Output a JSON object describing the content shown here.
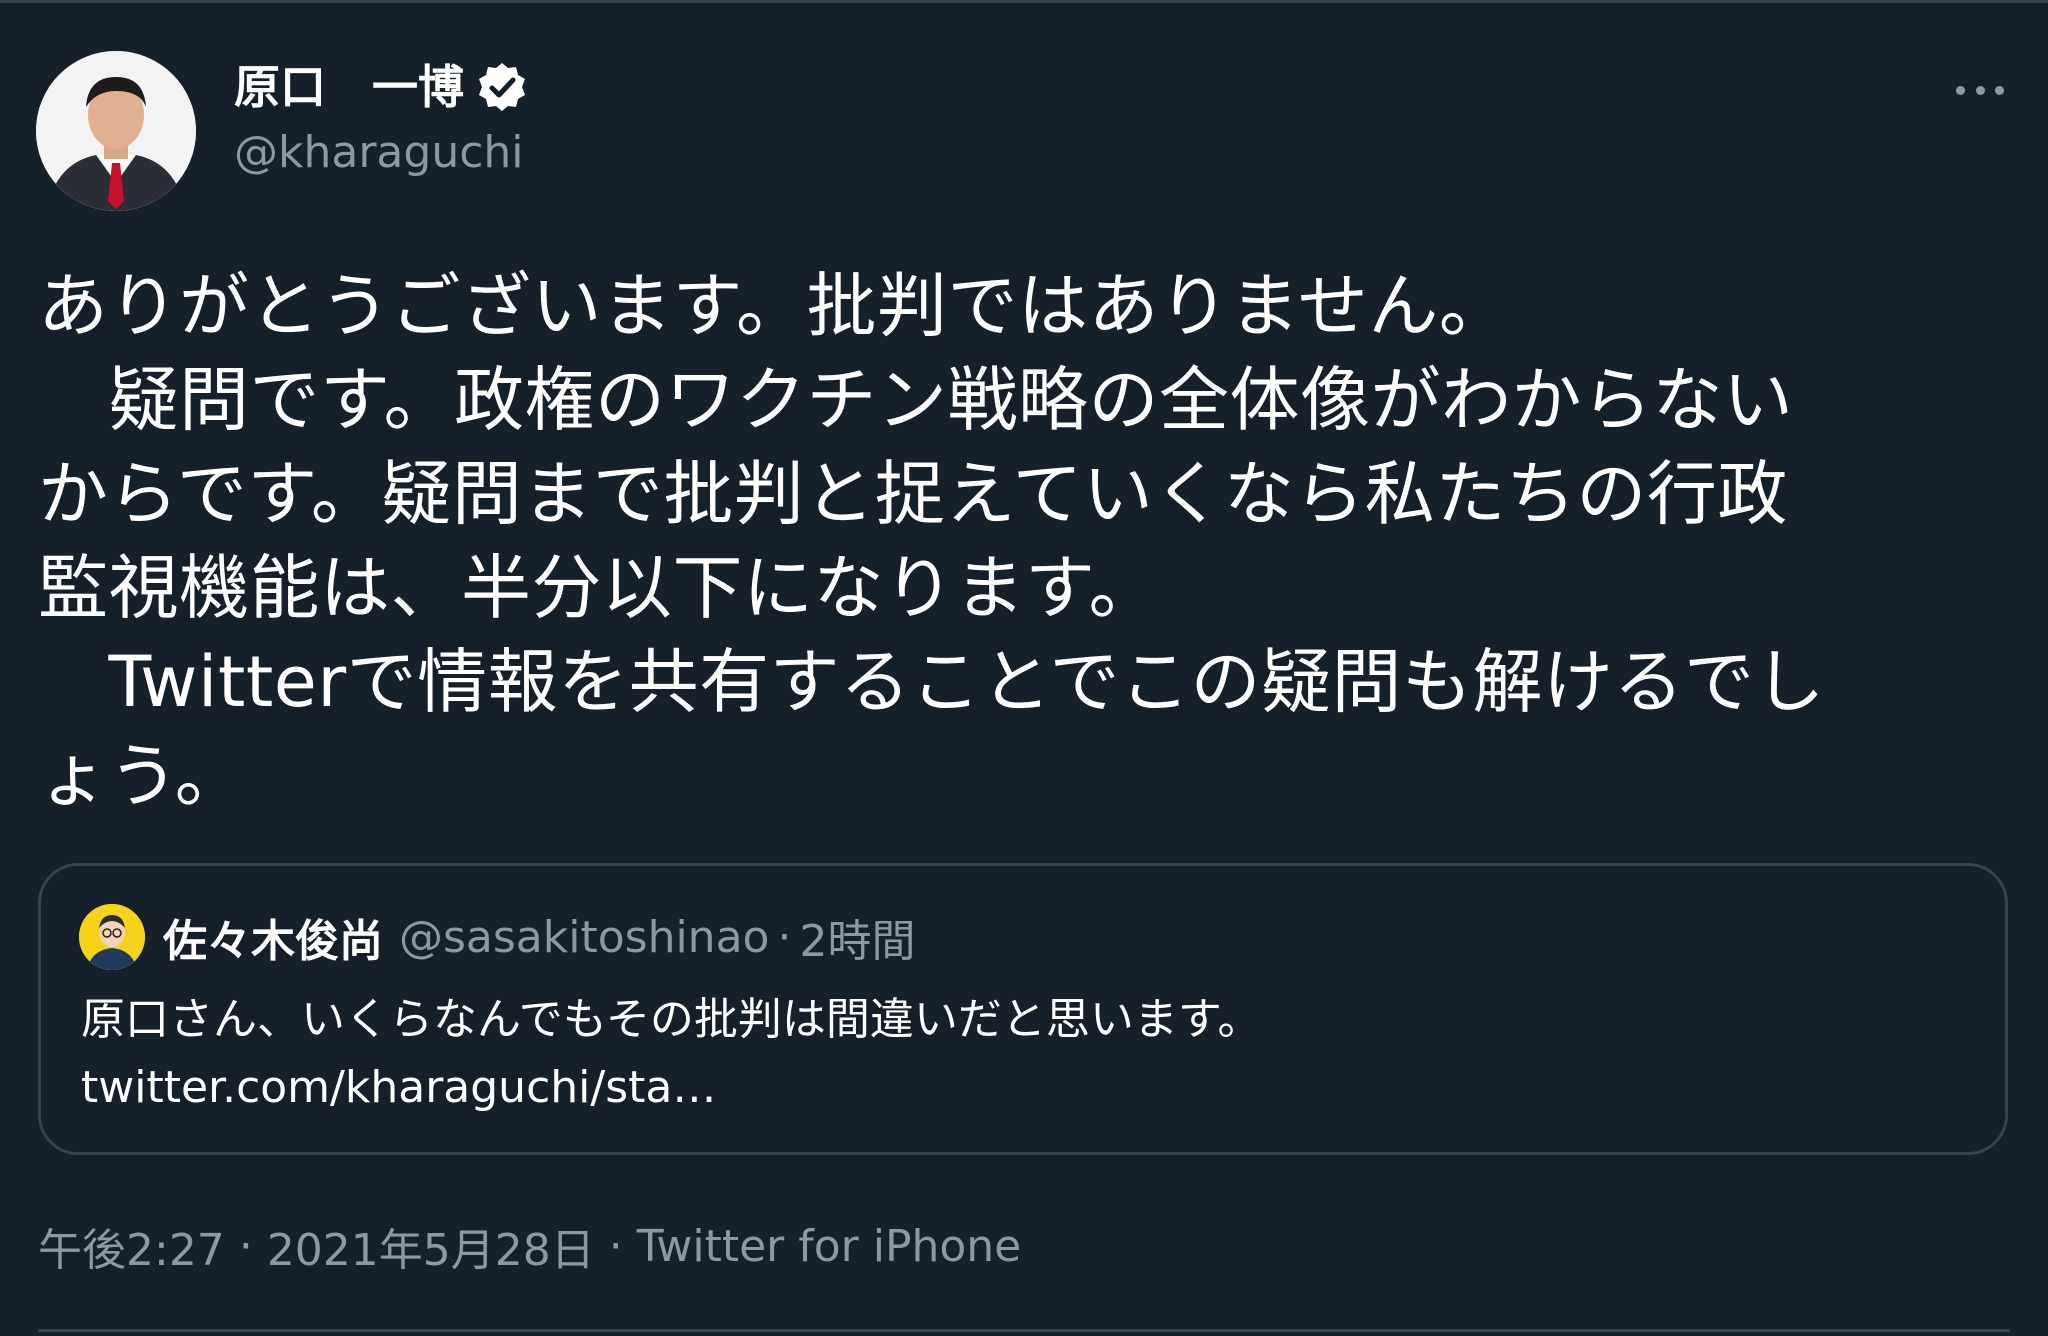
{
  "author": {
    "name": "原口　一博",
    "handle": "@kharaguchi"
  },
  "tweet": {
    "text": "ありがとうございます。批判ではありません。\n　疑問です。政権のワクチン戦略の全体像がわからない\nからです。疑問まで批判と捉えていくなら私たちの行政\n監視機能は、半分以下になります。\n　Twitterで情報を共有することでこの疑問も解けるでし\nょう。"
  },
  "quoted": {
    "name": "佐々木俊尚",
    "handle": "@sasakitoshinao",
    "separator": "·",
    "time": "2時間",
    "text": "原口さん、いくらなんでもその批判は間違いだと思います。\ntwitter.com/kharaguchi/sta…"
  },
  "meta": {
    "time": "午後2:27",
    "separator": "·",
    "date": "2021年5月28日",
    "source": "Twitter for iPhone"
  },
  "icons": {
    "verified": "verified-badge-icon",
    "more": "more-options-icon"
  },
  "colors": {
    "background": "#15202b",
    "text": "#ffffff",
    "secondary": "#8b98a5",
    "border": "#38444d"
  }
}
